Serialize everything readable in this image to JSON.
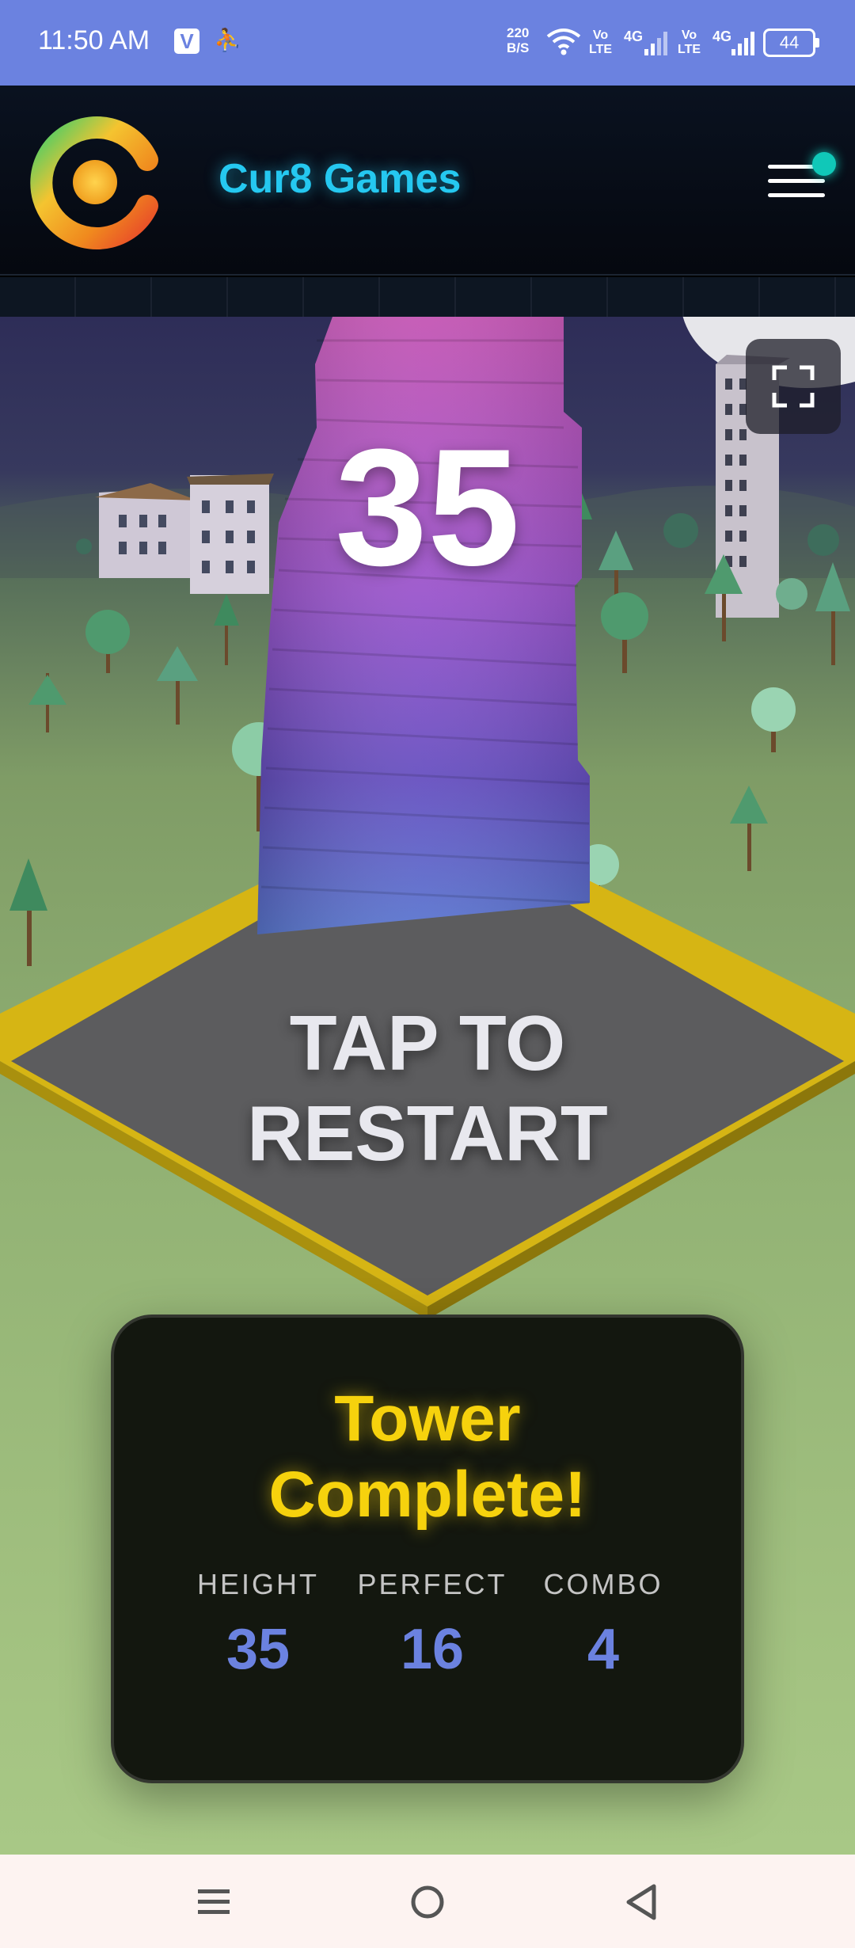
{
  "status_bar": {
    "time": "11:50 AM",
    "v_badge": "V",
    "net_speed_value": "220",
    "net_speed_unit": "B/S",
    "sim1_vo": "Vo",
    "sim1_lte": "LTE",
    "sim1_gen": "4G",
    "sim2_vo": "Vo",
    "sim2_lte": "LTE",
    "sim2_gen": "4G",
    "battery": "44"
  },
  "header": {
    "brand": "Cur8 Games",
    "logo_icon": "cur8-logo-icon",
    "menu_icon": "hamburger-menu-icon",
    "notification_color": "#10c8b8"
  },
  "game": {
    "score": "35",
    "restart_line1": "TAP TO",
    "restart_line2": "RESTART",
    "fullscreen_icon": "fullscreen-icon"
  },
  "result": {
    "title_line1": "Tower",
    "title_line2": "Complete!",
    "stats": [
      {
        "label": "HEIGHT",
        "value": "35"
      },
      {
        "label": "PERFECT",
        "value": "16"
      },
      {
        "label": "COMBO",
        "value": "4"
      }
    ]
  },
  "nav": {
    "recents_icon": "recents-icon",
    "home_icon": "home-icon",
    "back_icon": "back-icon"
  },
  "colors": {
    "status_bar": "#6b82e0",
    "brand": "#25c8f0",
    "title": "#f6d20d",
    "stat_value": "#6b82e0"
  }
}
